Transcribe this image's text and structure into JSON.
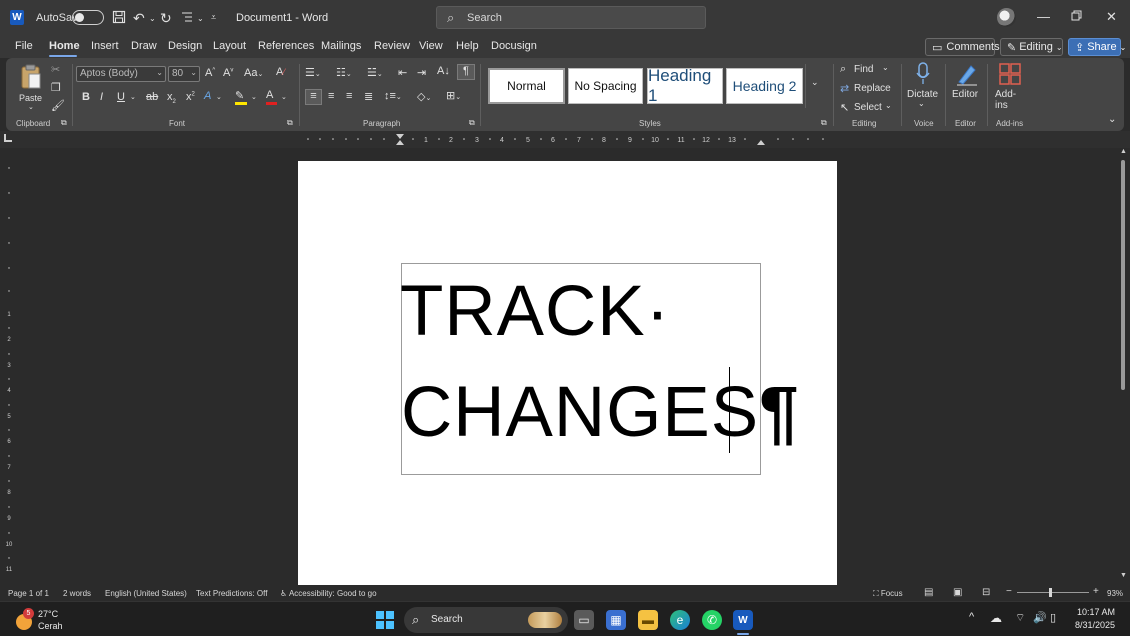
{
  "window": {
    "autosave_label": "AutoSave",
    "doc_title": "Document1 - Word",
    "search_placeholder": "Search",
    "app_icon": "W"
  },
  "menu": {
    "tabs": [
      "File",
      "Home",
      "Insert",
      "Draw",
      "Design",
      "Layout",
      "References",
      "Mailings",
      "Review",
      "View",
      "Help",
      "Docusign"
    ],
    "active_tab": "Home",
    "comments_label": "Comments",
    "editing_label": "Editing",
    "share_label": "Share"
  },
  "ribbon": {
    "clipboard": {
      "paste_label": "Paste",
      "group_label": "Clipboard"
    },
    "font": {
      "font_name": "Aptos (Body)",
      "font_size": "80",
      "group_label": "Font",
      "bold": "B",
      "italic": "I",
      "underline": "U"
    },
    "paragraph": {
      "group_label": "Paragraph"
    },
    "styles": {
      "items": [
        "Normal",
        "No Spacing",
        "Heading 1",
        "Heading 2"
      ],
      "group_label": "Styles"
    },
    "editing": {
      "find": "Find",
      "replace": "Replace",
      "select": "Select",
      "group_label": "Editing"
    },
    "voice": {
      "dictate": "Dictate",
      "group_label": "Voice"
    },
    "editor": {
      "label": "Editor",
      "group_label": "Editor"
    },
    "addins": {
      "label": "Add-ins",
      "group_label": "Add-ins"
    }
  },
  "document": {
    "line1": "TRACK",
    "line1_mark": "·",
    "line2": "CHANGES",
    "paragraph_mark": "¶"
  },
  "status": {
    "page": "Page 1 of 1",
    "words": "2 words",
    "language": "English (United States)",
    "predictions": "Text Predictions: Off",
    "accessibility": "Accessibility: Good to go",
    "focus": "Focus",
    "zoom": "93%"
  },
  "taskbar": {
    "weather_temp": "27°C",
    "weather_desc": "Cerah",
    "weather_badge": "5",
    "search_label": "Search",
    "time": "10:17 AM",
    "date": "8/31/2025"
  }
}
